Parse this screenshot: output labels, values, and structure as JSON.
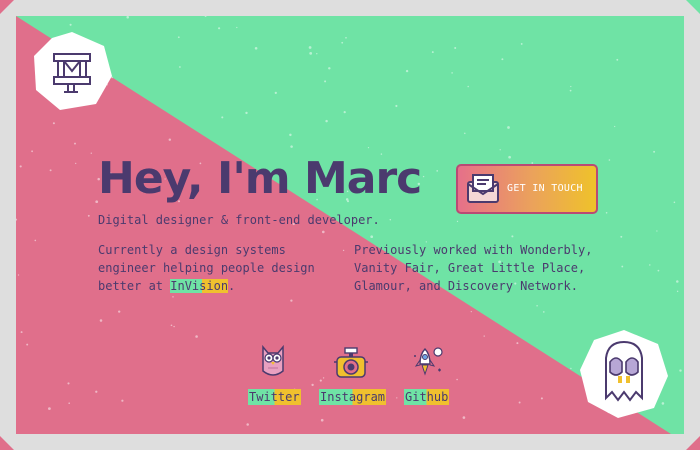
{
  "colors": {
    "pink": "#e06f8b",
    "green": "#6fe3a5",
    "purple": "#4b3a6e",
    "yellow": "#f0c02e",
    "frame": "#dedede"
  },
  "logo": {
    "icon": "mf-monogram-icon"
  },
  "hero": {
    "title": "Hey, I'm Marc",
    "tagline": "Digital designer & front-end developer."
  },
  "cta": {
    "label": "GET IN TOUCH",
    "icon": "mail-envelope-icon"
  },
  "bio": {
    "left_before": "Currently a design systems engineer helping people design better at ",
    "left_link": "InVision",
    "left_after": ".",
    "right": "Previously worked with Wonderbly, Vanity Fair, Great Little Place, Glamour, and Discovery Network."
  },
  "social": [
    {
      "label": "Twitter",
      "icon": "owl-icon"
    },
    {
      "label": "Instagram",
      "icon": "camera-icon"
    },
    {
      "label": "Github",
      "icon": "rocket-icon"
    }
  ],
  "mascot": {
    "icon": "ghost-icon"
  }
}
